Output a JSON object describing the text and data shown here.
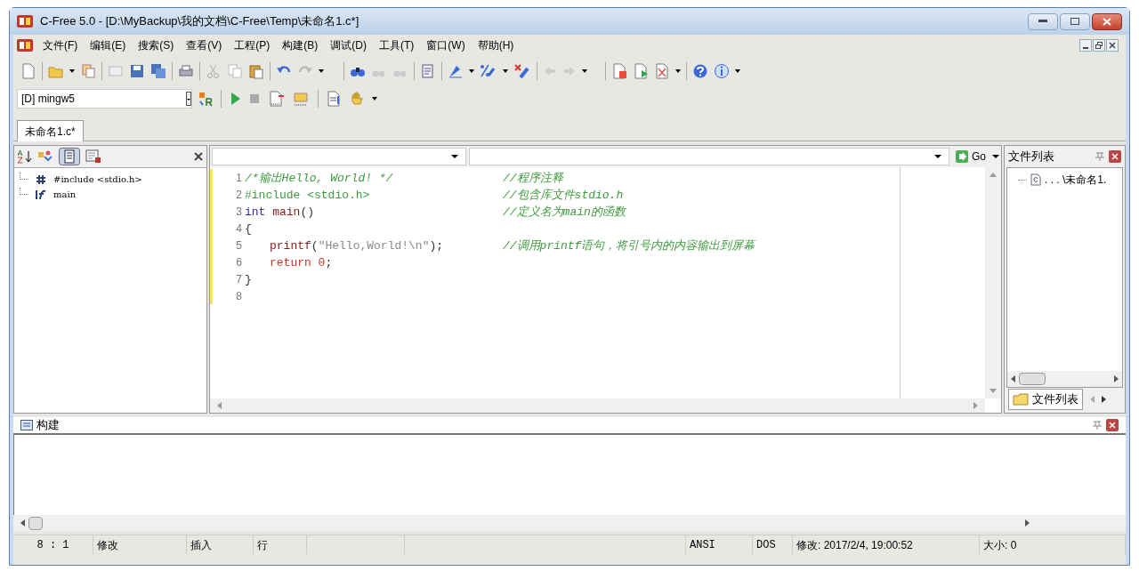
{
  "window": {
    "title": "C-Free 5.0 - [D:\\MyBackup\\我的文档\\C-Free\\Temp\\未命名1.c*]"
  },
  "menu": [
    "文件(F)",
    "编辑(E)",
    "搜索(S)",
    "查看(V)",
    "工程(P)",
    "构建(B)",
    "调试(D)",
    "工具(T)",
    "窗口(W)",
    "帮助(H)"
  ],
  "compiler_select": {
    "value": "[D] mingw5"
  },
  "doc_tabs": [
    {
      "label": "未命名1.c*",
      "selected": true
    }
  ],
  "symbol_panel": {
    "items": [
      {
        "kind": "include",
        "label": "#include <stdio.h>"
      },
      {
        "kind": "function",
        "label": "main"
      }
    ]
  },
  "editor": {
    "go_button": "Go",
    "lines": [
      {
        "number": "1",
        "indented": false,
        "code": [
          {
            "kind": "comment",
            "text": "/*输出Hello, World! */"
          }
        ],
        "comment": "//程序注释"
      },
      {
        "number": "2",
        "indented": false,
        "code": [
          {
            "kind": "preproc",
            "text": "#include <stdio.h>"
          }
        ],
        "comment": "//包含库文件stdio.h"
      },
      {
        "number": "3",
        "indented": false,
        "code": [
          {
            "kind": "type",
            "text": "int"
          },
          {
            "kind": "identifier",
            "text": " main"
          },
          {
            "kind": "punct",
            "text": "()"
          }
        ],
        "comment": "//定义名为main的函数"
      },
      {
        "number": "4",
        "indented": false,
        "code": [
          {
            "kind": "punct",
            "text": "{"
          }
        ]
      },
      {
        "number": "5",
        "indented": true,
        "code": [
          {
            "kind": "identifier",
            "text": "printf"
          },
          {
            "kind": "punct",
            "text": "("
          },
          {
            "kind": "string",
            "text": "\"Hello,World!\\n\""
          },
          {
            "kind": "punct",
            "text": ");"
          }
        ],
        "comment": "//调用printf语句，将引号内的内容输出到屏幕"
      },
      {
        "number": "6",
        "indented": true,
        "code": [
          {
            "kind": "keyword",
            "text": "return"
          },
          {
            "kind": "number",
            "text": " 0"
          },
          {
            "kind": "punct",
            "text": ";"
          }
        ]
      },
      {
        "number": "7",
        "indented": false,
        "code": [
          {
            "kind": "punct",
            "text": "}"
          }
        ]
      },
      {
        "number": "8"
      }
    ]
  },
  "file_list": {
    "title": "文件列表",
    "items": [
      ". . . \\未命名1."
    ],
    "tab": "文件列表"
  },
  "build_panel": {
    "title": "构建"
  },
  "status_bar": {
    "position": "8 : 1",
    "modified": "修改",
    "insert_mode": "插入",
    "line_mode": "行",
    "encoding": "ANSI",
    "line_endings": "DOS",
    "modified_time": "修改: 2017/2/4, 19:00:52",
    "size": "大小: 0"
  }
}
